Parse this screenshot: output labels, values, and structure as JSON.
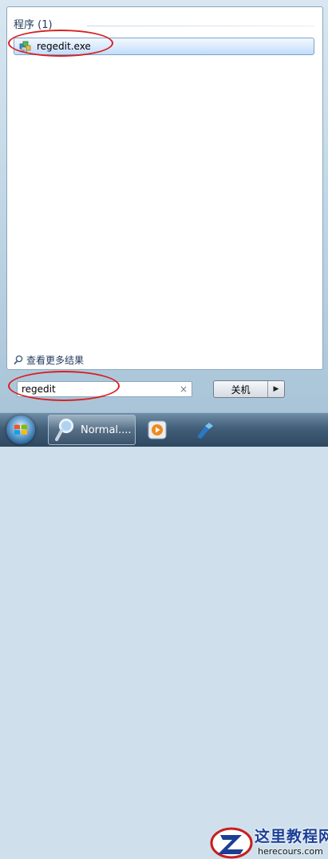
{
  "results": {
    "group_header": "程序 (1)",
    "items": [
      {
        "label": "regedit.exe",
        "icon": "regedit-icon"
      }
    ],
    "see_more": "查看更多结果"
  },
  "search": {
    "value": "regedit",
    "clear_symbol": "×"
  },
  "shutdown": {
    "label": "关机",
    "arrow_symbol": "▶"
  },
  "taskbar": {
    "task_label": "Normal....",
    "task_icon": "magnifier-icon",
    "pinned_icons": [
      "media-player-icon",
      "tray-app-icon"
    ]
  },
  "watermark": {
    "title": "这里教程网",
    "url": "herecours.com"
  },
  "colors": {
    "annotation": "#d52323",
    "header_text": "#1e395b",
    "selection": "#c1dcfb"
  }
}
